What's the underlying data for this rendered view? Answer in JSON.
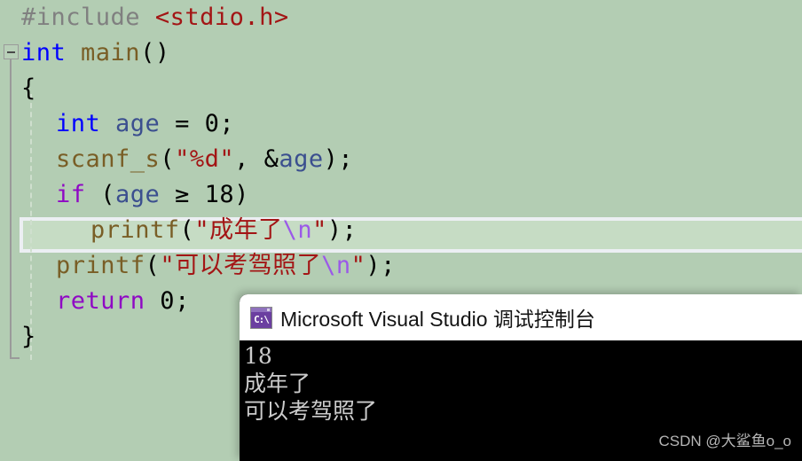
{
  "theme": {
    "editor_background": "#b3cdb3",
    "highlight_background": "#c6dcc4",
    "highlight_border": "#eceff3",
    "console_background": "#000000",
    "console_text": "#cccccc",
    "titlebar_background": "#ffffff",
    "icon_color": "#6b3fa0",
    "preprocessor_color": "#808080",
    "include_color": "#a31515",
    "keyword_color": "#0000ff",
    "control_keyword_color": "#8f08c4",
    "function_color": "#795e26",
    "variable_color": "#3b4f8f",
    "string_color": "#a31515",
    "escape_color": "#9b59e8",
    "gutter_color": "#9a9a9a"
  },
  "editor": {
    "language": "c",
    "fold_marker": "minus",
    "lines": [
      {
        "index": 0,
        "indent": 0,
        "highlighted": false,
        "tokens": [
          {
            "text": "#include ",
            "type": "pre"
          },
          {
            "text": "<stdio.h>",
            "type": "inc"
          }
        ]
      },
      {
        "index": 1,
        "indent": 0,
        "highlighted": false,
        "tokens": [
          {
            "text": "int ",
            "type": "kw"
          },
          {
            "text": "main",
            "type": "fn"
          },
          {
            "text": "()",
            "type": "punct"
          }
        ]
      },
      {
        "index": 2,
        "indent": 0,
        "highlighted": false,
        "tokens": [
          {
            "text": "{",
            "type": "punct"
          }
        ]
      },
      {
        "index": 3,
        "indent": 1,
        "highlighted": false,
        "tokens": [
          {
            "text": "int ",
            "type": "kw"
          },
          {
            "text": "age",
            "type": "var"
          },
          {
            "text": " = ",
            "type": "punct"
          },
          {
            "text": "0",
            "type": "num"
          },
          {
            "text": ";",
            "type": "punct"
          }
        ]
      },
      {
        "index": 4,
        "indent": 1,
        "highlighted": false,
        "tokens": [
          {
            "text": "scanf_s",
            "type": "fn"
          },
          {
            "text": "(",
            "type": "punct"
          },
          {
            "text": "\"%d\"",
            "type": "str"
          },
          {
            "text": ", &",
            "type": "punct"
          },
          {
            "text": "age",
            "type": "var"
          },
          {
            "text": ");",
            "type": "punct"
          }
        ]
      },
      {
        "index": 5,
        "indent": 1,
        "highlighted": false,
        "tokens": [
          {
            "text": "if ",
            "type": "ctl"
          },
          {
            "text": "(",
            "type": "punct"
          },
          {
            "text": "age",
            "type": "var"
          },
          {
            "text": " ≥ ",
            "type": "punct"
          },
          {
            "text": "18",
            "type": "num"
          },
          {
            "text": ")",
            "type": "punct"
          }
        ]
      },
      {
        "index": 6,
        "indent": 2,
        "highlighted": true,
        "tokens": [
          {
            "text": "printf",
            "type": "fn"
          },
          {
            "text": "(",
            "type": "punct"
          },
          {
            "text": "\"成年了",
            "type": "str"
          },
          {
            "text": "\\n",
            "type": "esc"
          },
          {
            "text": "\"",
            "type": "str"
          },
          {
            "text": ");",
            "type": "punct"
          }
        ]
      },
      {
        "index": 7,
        "indent": 1,
        "highlighted": false,
        "tokens": [
          {
            "text": "printf",
            "type": "fn"
          },
          {
            "text": "(",
            "type": "punct"
          },
          {
            "text": "\"可以考驾照了",
            "type": "str"
          },
          {
            "text": "\\n",
            "type": "esc"
          },
          {
            "text": "\"",
            "type": "str"
          },
          {
            "text": ");",
            "type": "punct"
          }
        ]
      },
      {
        "index": 8,
        "indent": 1,
        "highlighted": false,
        "tokens": [
          {
            "text": "return ",
            "type": "ctl"
          },
          {
            "text": "0",
            "type": "num"
          },
          {
            "text": ";",
            "type": "punct"
          }
        ]
      },
      {
        "index": 9,
        "indent": 0,
        "highlighted": false,
        "tokens": [
          {
            "text": "}",
            "type": "punct"
          }
        ]
      }
    ]
  },
  "console": {
    "title": "Microsoft Visual Studio 调试控制台",
    "icon_label": "C:\\",
    "output_lines": [
      "18",
      "成年了",
      "可以考驾照了"
    ],
    "watermark": "CSDN @大鲨鱼o_o"
  }
}
